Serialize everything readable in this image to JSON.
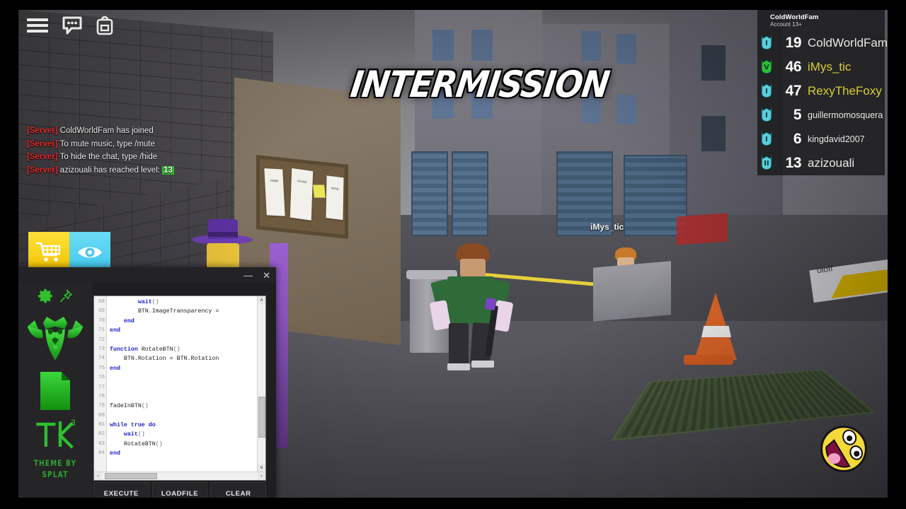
{
  "game": {
    "status_banner": "INTERMISSION",
    "topbar_icons": [
      {
        "name": "menu-icon",
        "label": "Menu"
      },
      {
        "name": "chat-icon",
        "label": "Chat"
      },
      {
        "name": "backpack-icon",
        "label": "Backpack"
      }
    ],
    "side_buttons": [
      {
        "name": "shop-button",
        "label": "Shop",
        "color": "#ffd92b"
      },
      {
        "name": "spectate-button",
        "label": "Spectate",
        "color": "#4fd0f0"
      }
    ],
    "world_nametags": [
      {
        "text": "iMys_tic",
        "style": "light"
      },
      {
        "text": "0loff",
        "style": "dark"
      }
    ],
    "board_papers": [
      "xWjtkk",
      "kOubijt",
      "tteZdy"
    ]
  },
  "chat": {
    "messages": [
      {
        "tag": "[Server]",
        "text": "ColdWorldFam has joined",
        "level": null
      },
      {
        "tag": "[Server]",
        "text": "To mute music, type /mute",
        "level": null
      },
      {
        "tag": "[Server]",
        "text": "To hide the chat, type /hide",
        "level": null
      },
      {
        "tag": "[Server]",
        "text": "azizouali has reached level:",
        "level": "13"
      }
    ],
    "tag_color": "#e02b2b",
    "level_badge_color": "#2fbf2f"
  },
  "leaderboard": {
    "account_name": "ColdWorldFam",
    "account_sub": "Account 13+",
    "rows": [
      {
        "badge": "I",
        "badge_color": "#5fe0e8",
        "score": "19",
        "name": "ColdWorldFam",
        "name_color": "white",
        "size": "big"
      },
      {
        "badge": "V",
        "badge_color": "#2fd02f",
        "score": "46",
        "name": "iMys_tic",
        "name_color": "gold",
        "size": "big"
      },
      {
        "badge": "I",
        "badge_color": "#5fe0e8",
        "score": "47",
        "name": "RexyTheFoxy",
        "name_color": "gold",
        "size": "big"
      },
      {
        "badge": "I",
        "badge_color": "#5fe0e8",
        "score": "5",
        "name": "guillermomosquera",
        "name_color": "white",
        "size": "sm"
      },
      {
        "badge": "I",
        "badge_color": "#5fe0e8",
        "score": "6",
        "name": "kingdavid2007",
        "name_color": "white",
        "size": "sm"
      },
      {
        "badge": "II",
        "badge_color": "#5fe0e8",
        "score": "13",
        "name": "azizouali",
        "name_color": "white",
        "size": "big"
      }
    ]
  },
  "exploit": {
    "window_controls": {
      "minimize": "—",
      "close": "✕"
    },
    "sidebar": {
      "gear_icon": "gear-icon",
      "pin_icon": "pin-icon",
      "logo_icon": "cerberus-logo-icon",
      "file_icon": "script-file-icon",
      "tk_logo": "TK",
      "tk_sup": "3",
      "theme_credit_line1": "THEME BY",
      "theme_credit_line2": "SPLAT"
    },
    "buttons": [
      {
        "name": "execute-button",
        "label": "EXECUTE"
      },
      {
        "name": "loadfile-button",
        "label": "LOADFILE"
      },
      {
        "name": "clear-button",
        "label": "CLEAR"
      }
    ],
    "editor": {
      "first_line_number": 68,
      "lines": [
        {
          "n": 68,
          "segs": [
            {
              "t": "        ",
              "c": "id"
            },
            {
              "t": "wait",
              "c": "fn"
            },
            {
              "t": "()",
              "c": "pn"
            }
          ]
        },
        {
          "n": 69,
          "segs": [
            {
              "t": "        BTN.ImageTransparency =",
              "c": "id"
            }
          ]
        },
        {
          "n": 70,
          "segs": [
            {
              "t": "    ",
              "c": "id"
            },
            {
              "t": "end",
              "c": "kw"
            }
          ]
        },
        {
          "n": 71,
          "segs": [
            {
              "t": "end",
              "c": "kw"
            }
          ]
        },
        {
          "n": 72,
          "segs": []
        },
        {
          "n": 73,
          "segs": [
            {
              "t": "function ",
              "c": "kw"
            },
            {
              "t": "RotateBTN",
              "c": "id"
            },
            {
              "t": "()",
              "c": "pn"
            }
          ]
        },
        {
          "n": 74,
          "segs": [
            {
              "t": "    BTN.Rotation = BTN.Rotation",
              "c": "id"
            }
          ]
        },
        {
          "n": 75,
          "segs": [
            {
              "t": "end",
              "c": "kw"
            }
          ]
        },
        {
          "n": 76,
          "segs": []
        },
        {
          "n": 77,
          "segs": []
        },
        {
          "n": 78,
          "segs": []
        },
        {
          "n": 79,
          "segs": [
            {
              "t": "fadeInBTN",
              "c": "id"
            },
            {
              "t": "()",
              "c": "pn"
            }
          ]
        },
        {
          "n": 80,
          "segs": []
        },
        {
          "n": 81,
          "segs": [
            {
              "t": "while true do",
              "c": "kw"
            }
          ]
        },
        {
          "n": 82,
          "segs": [
            {
              "t": "    ",
              "c": "id"
            },
            {
              "t": "wait",
              "c": "fn"
            },
            {
              "t": "()",
              "c": "pn"
            }
          ]
        },
        {
          "n": 83,
          "segs": [
            {
              "t": "    ",
              "c": "id"
            },
            {
              "t": "RotateBTN",
              "c": "id"
            },
            {
              "t": "()",
              "c": "pn"
            }
          ]
        },
        {
          "n": 84,
          "segs": [
            {
              "t": "end",
              "c": "kw"
            }
          ]
        }
      ],
      "scroll_up_arrow": "∧",
      "scroll_down_arrow": "∨",
      "scroll_left_arrow": "‹",
      "scroll_right_arrow": "›"
    }
  }
}
